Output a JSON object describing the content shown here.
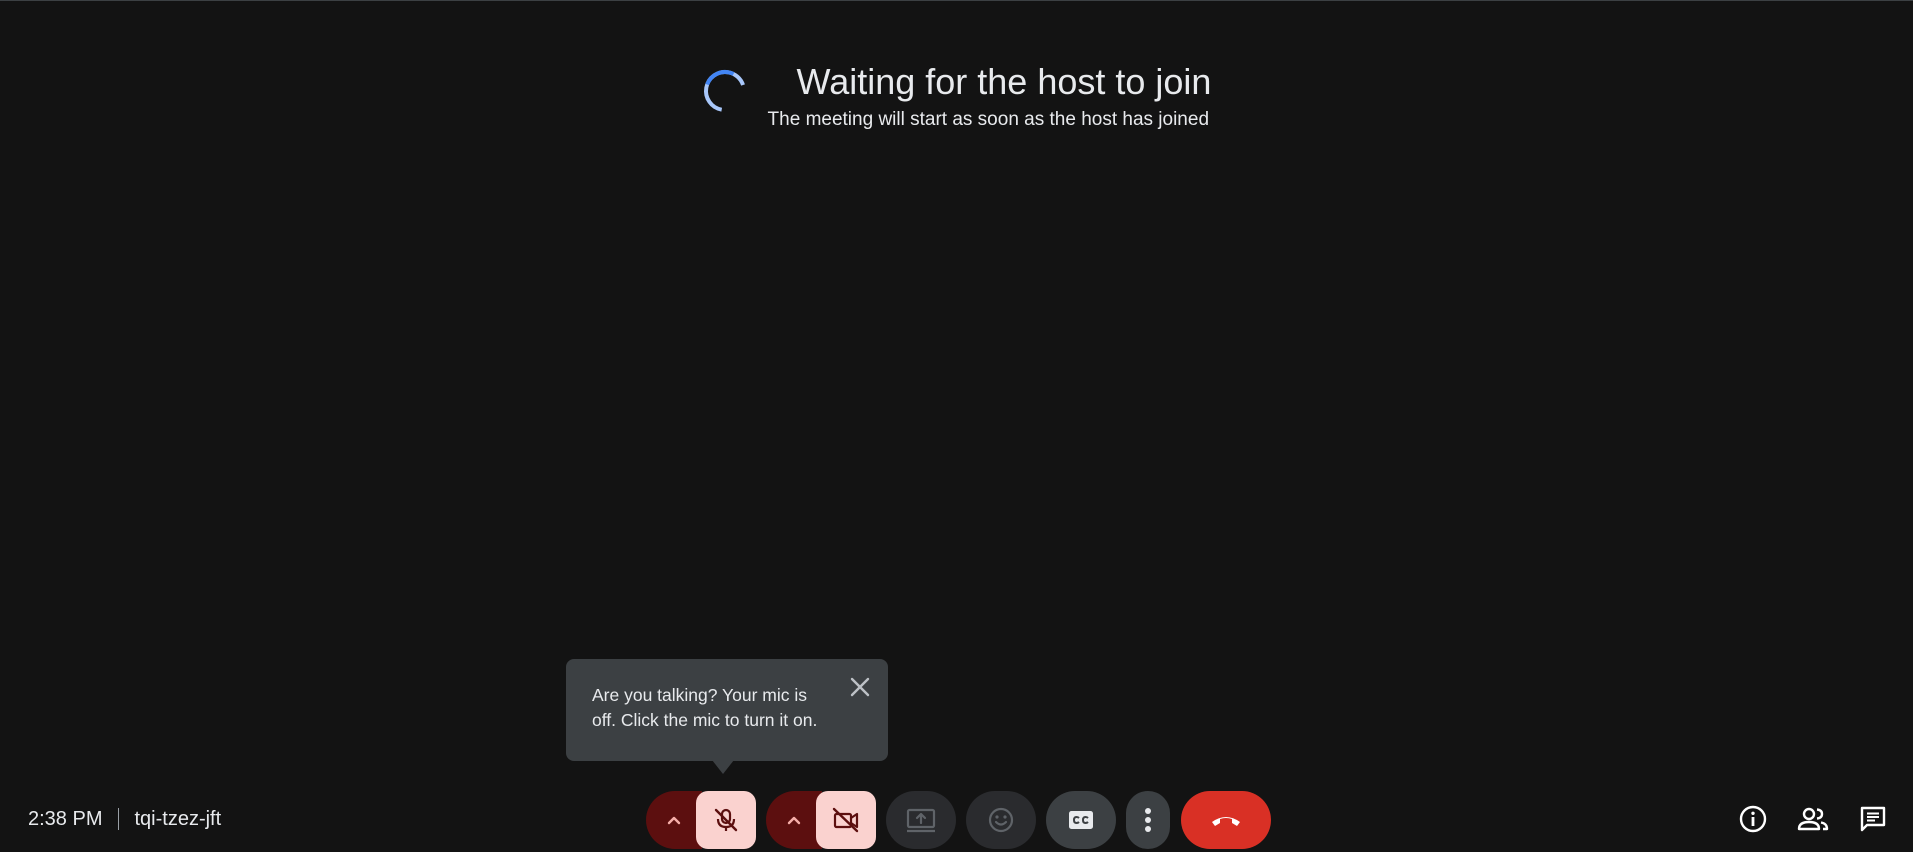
{
  "waiting": {
    "title": "Waiting for the host to join",
    "subtitle": "The meeting will start as soon as the host has joined"
  },
  "tooltip": {
    "text": "Are you talking? Your mic is off. Click the mic to turn it on."
  },
  "meeting": {
    "time": "2:38 PM",
    "code": "tqi-tzez-jft"
  },
  "controls": {
    "mic_state": "off",
    "camera_state": "off",
    "icons": [
      "chevron-up-icon",
      "mic-off-icon",
      "videocam-off-icon",
      "present-screen-icon",
      "emoji-icon",
      "captions-icon",
      "more-vert-icon",
      "call-end-icon"
    ]
  },
  "right_icons": [
    "info-icon",
    "people-icon",
    "chat-icon"
  ],
  "colors": {
    "background": "#131313",
    "mic_off_dark": "#5c0f0f",
    "mic_off_light": "#fad2cf",
    "end_call": "#d93025",
    "spinner_blue": "#4285f4",
    "spinner_light": "#a8c7fa"
  }
}
